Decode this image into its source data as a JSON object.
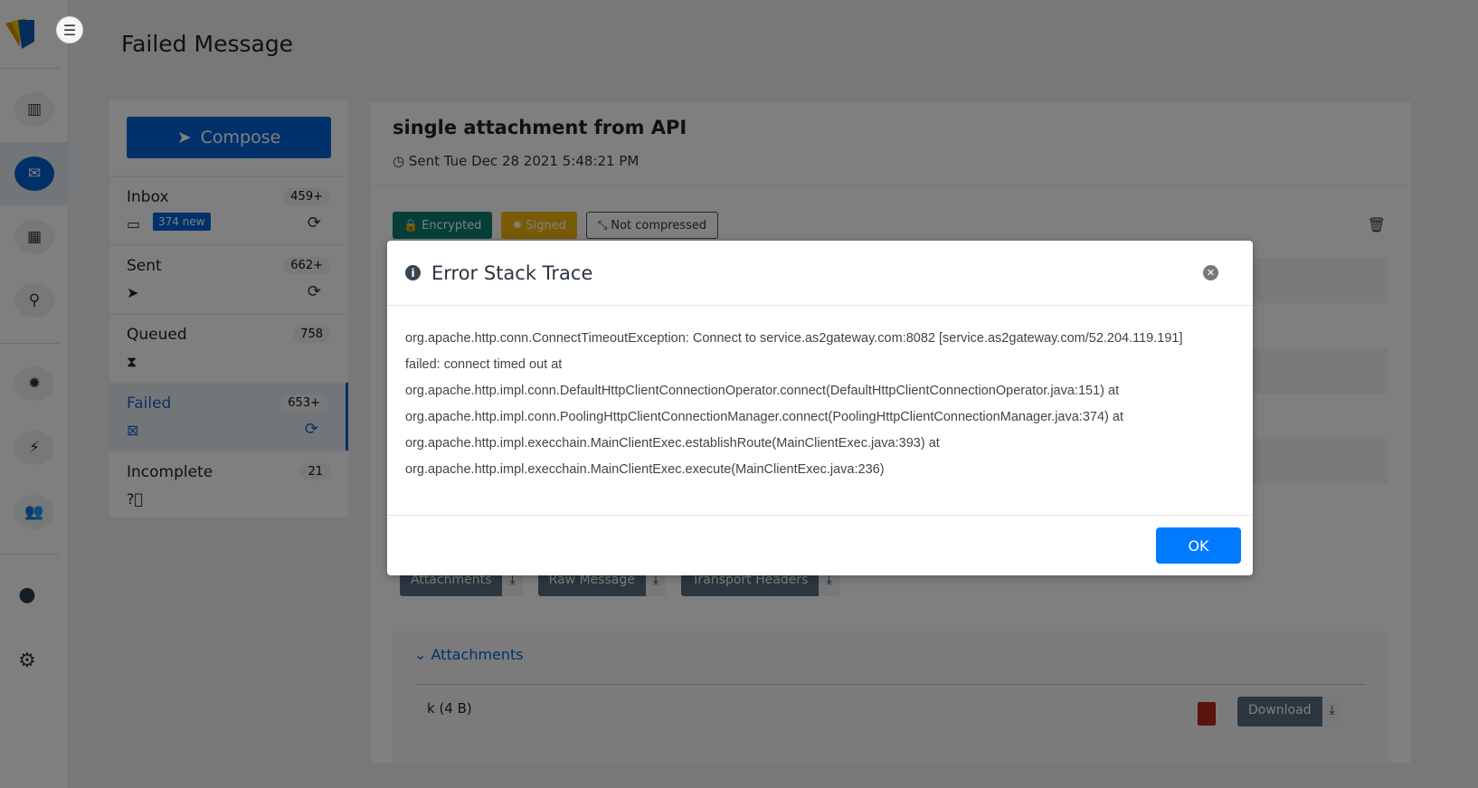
{
  "page": {
    "title": "Failed Message"
  },
  "compose": {
    "label": "Compose"
  },
  "folders": [
    {
      "name": "Inbox",
      "count": "459+",
      "new": "374 new",
      "icon": "inbox-icon"
    },
    {
      "name": "Sent",
      "count": "662+",
      "icon": "paper-plane-icon"
    },
    {
      "name": "Queued",
      "count": "758",
      "icon": "hourglass-icon"
    },
    {
      "name": "Failed",
      "count": "653+",
      "icon": "x-box-icon"
    },
    {
      "name": "Incomplete",
      "count": "21",
      "icon": "question-circle-icon"
    }
  ],
  "message": {
    "subject": "single attachment from API",
    "sent": "Sent Tue Dec 28 2021 5:48:21 PM",
    "badges": [
      "Encrypted",
      "Signed",
      "Not compressed"
    ],
    "buttons": [
      "Attachments",
      "Raw Message",
      "Transport Headers"
    ],
    "attachments_title": "Attachments",
    "file": "k (4 B)",
    "download": "Download"
  },
  "modal": {
    "title": "Error Stack Trace",
    "lines": [
      "org.apache.http.conn.ConnectTimeoutException: Connect to service.as2gateway.com:8082 [service.as2gateway.com/52.204.119.191]",
      "failed: connect timed out at",
      "org.apache.http.impl.conn.DefaultHttpClientConnectionOperator.connect(DefaultHttpClientConnectionOperator.java:151) at",
      "org.apache.http.impl.conn.PoolingHttpClientConnectionManager.connect(PoolingHttpClientConnectionManager.java:374) at",
      "org.apache.http.impl.execchain.MainClientExec.establishRoute(MainClientExec.java:393) at",
      "org.apache.http.impl.execchain.MainClientExec.execute(MainClientExec.java:236)"
    ],
    "ok": "OK"
  },
  "colors": {
    "primary": "#0062d6",
    "ok": "#007bff",
    "encrypted": "#0b7f71",
    "signed": "#f3b50c"
  }
}
